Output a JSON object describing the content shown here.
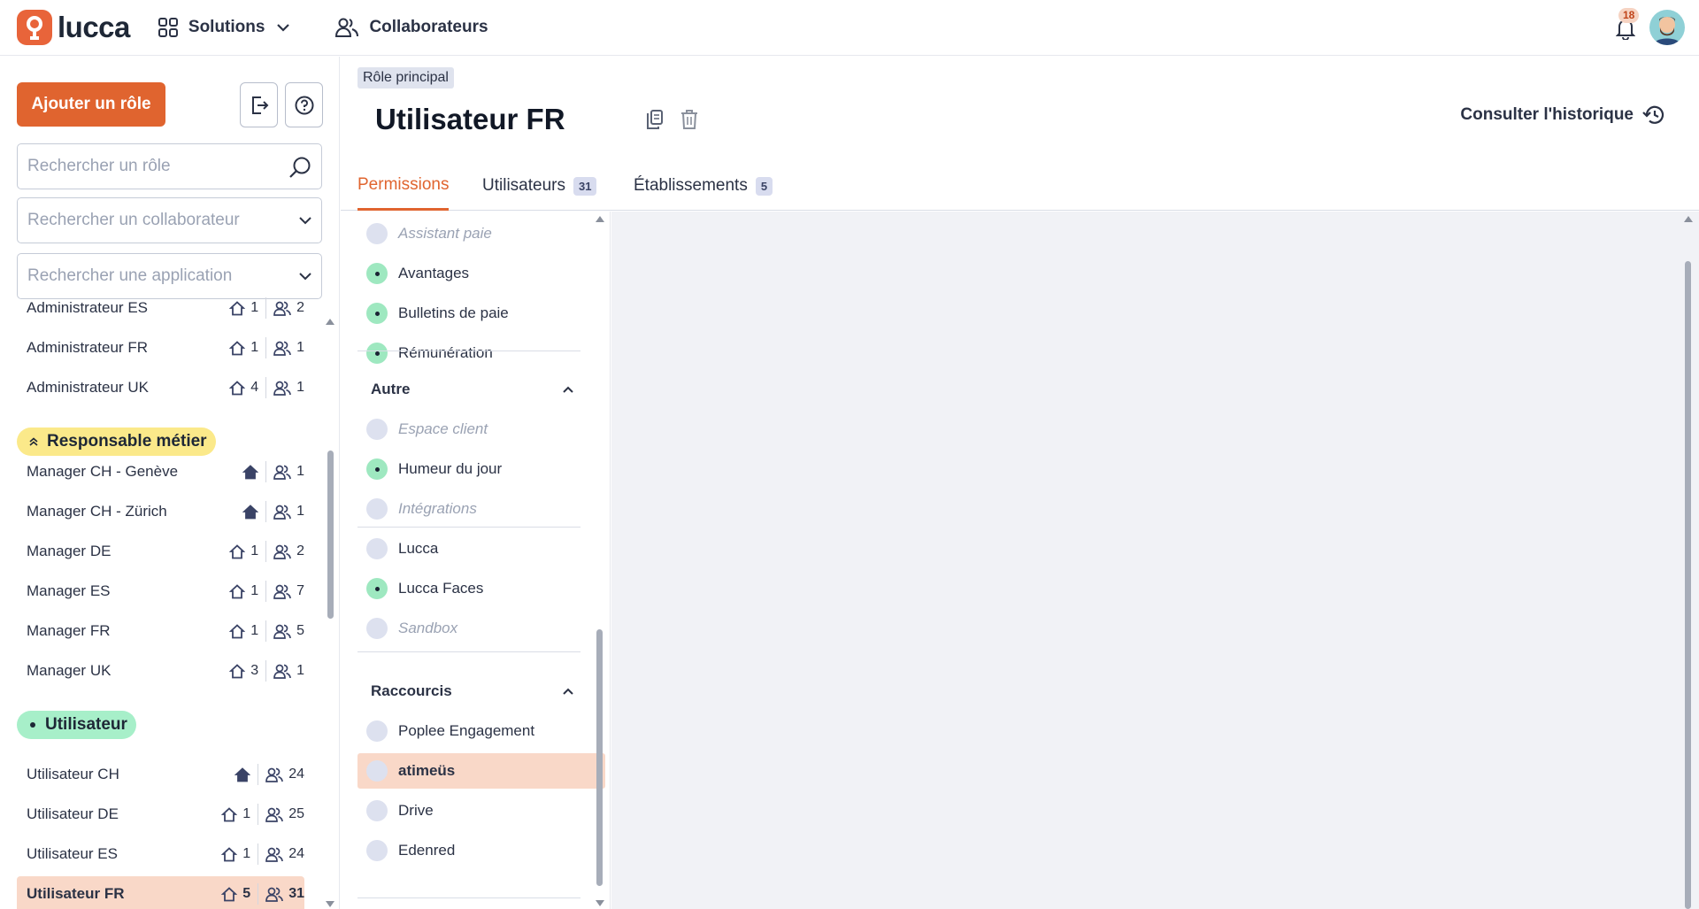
{
  "topbar": {
    "logo_text": "lucca",
    "nav": [
      {
        "label": "Solutions",
        "icon": "grid-icon"
      },
      {
        "label": "Collaborateurs",
        "icon": "users-icon"
      }
    ],
    "notifications_count": "18"
  },
  "sidebar": {
    "add_role_label": "Ajouter un rôle",
    "search_role_placeholder": "Rechercher un rôle",
    "search_collab_placeholder": "Rechercher un collaborateur",
    "search_app_placeholder": "Rechercher une application",
    "roles": [
      {
        "name": "Administrateur ES",
        "sites": "1",
        "users": "2"
      },
      {
        "name": "Administrateur FR",
        "sites": "1",
        "users": "1"
      },
      {
        "name": "Administrateur UK",
        "sites": "4",
        "users": "1"
      }
    ],
    "group_manager": {
      "label": "Responsable métier",
      "color": "#fbe98a"
    },
    "managers": [
      {
        "name": "Manager CH - Genève",
        "sites": "",
        "users": "1"
      },
      {
        "name": "Manager CH - Zürich",
        "sites": "",
        "users": "1"
      },
      {
        "name": "Manager DE",
        "sites": "1",
        "users": "2"
      },
      {
        "name": "Manager ES",
        "sites": "1",
        "users": "7"
      },
      {
        "name": "Manager FR",
        "sites": "1",
        "users": "5"
      },
      {
        "name": "Manager UK",
        "sites": "3",
        "users": "1"
      }
    ],
    "group_user": {
      "label": "Utilisateur",
      "color": "#a7efc9"
    },
    "users": [
      {
        "name": "Utilisateur CH",
        "sites": "",
        "users": "24"
      },
      {
        "name": "Utilisateur DE",
        "sites": "1",
        "users": "25"
      },
      {
        "name": "Utilisateur ES",
        "sites": "1",
        "users": "24"
      },
      {
        "name": "Utilisateur FR",
        "sites": "5",
        "users": "31"
      }
    ]
  },
  "main": {
    "tag": "Rôle principal",
    "title": "Utilisateur FR",
    "history_label": "Consulter l'historique",
    "tabs": [
      {
        "label": "Permissions",
        "count": ""
      },
      {
        "label": "Utilisateurs",
        "count": "31"
      },
      {
        "label": "Établissements",
        "count": "5"
      }
    ],
    "permissions_top": [
      {
        "label": "Assistant paie",
        "state": "off"
      },
      {
        "label": "Avantages",
        "state": "on"
      },
      {
        "label": "Bulletins de paie",
        "state": "on"
      },
      {
        "label": "Rémunération",
        "state": "on"
      }
    ],
    "section_autre": "Autre",
    "permissions_autre": [
      {
        "label": "Espace client",
        "state": "off"
      },
      {
        "label": "Humeur du jour",
        "state": "on"
      },
      {
        "label": "Intégrations",
        "state": "off"
      },
      {
        "label": "Lucca",
        "state": "none"
      },
      {
        "label": "Lucca Faces",
        "state": "on"
      },
      {
        "label": "Sandbox",
        "state": "off"
      }
    ],
    "section_raccourcis": "Raccourcis",
    "permissions_raccourcis": [
      {
        "label": "Poplee Engagement",
        "state": "none"
      },
      {
        "label": "atimeüs",
        "state": "none"
      },
      {
        "label": "Drive",
        "state": "none"
      },
      {
        "label": "Edenred",
        "state": "none"
      }
    ]
  },
  "colors": {
    "accent": "#e0642f",
    "brand": "#e8643a"
  }
}
